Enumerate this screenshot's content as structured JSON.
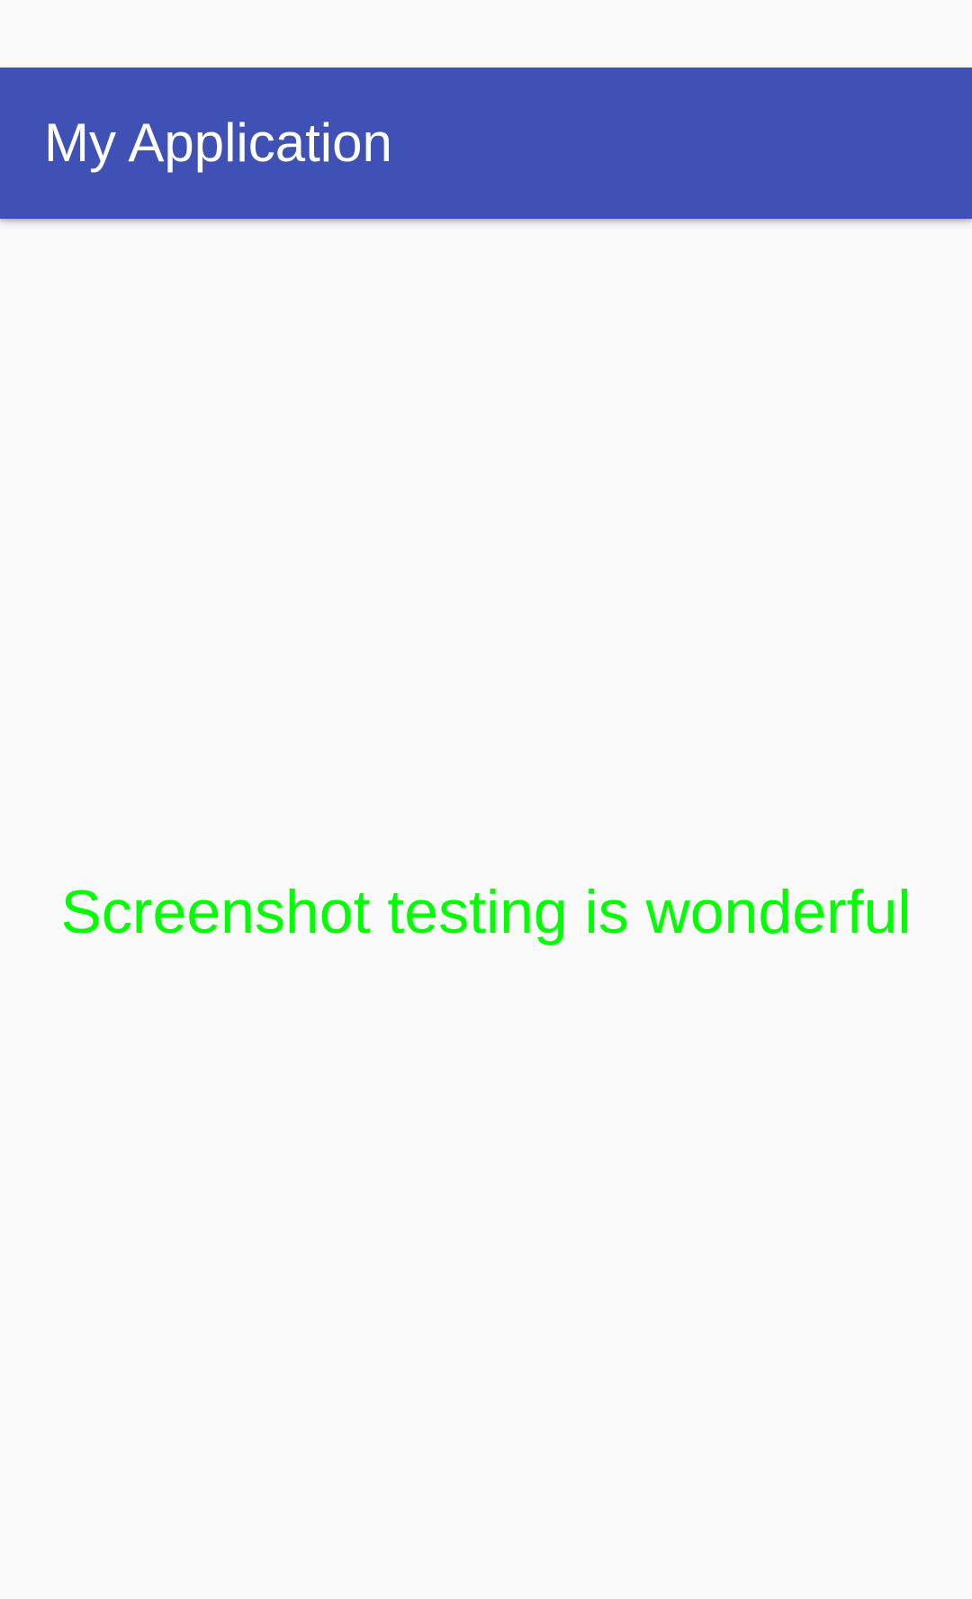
{
  "app_bar": {
    "title": "My Application",
    "color": "#3f51b5"
  },
  "content": {
    "message": "Screenshot testing is wonderful",
    "message_color": "#00ff00"
  }
}
